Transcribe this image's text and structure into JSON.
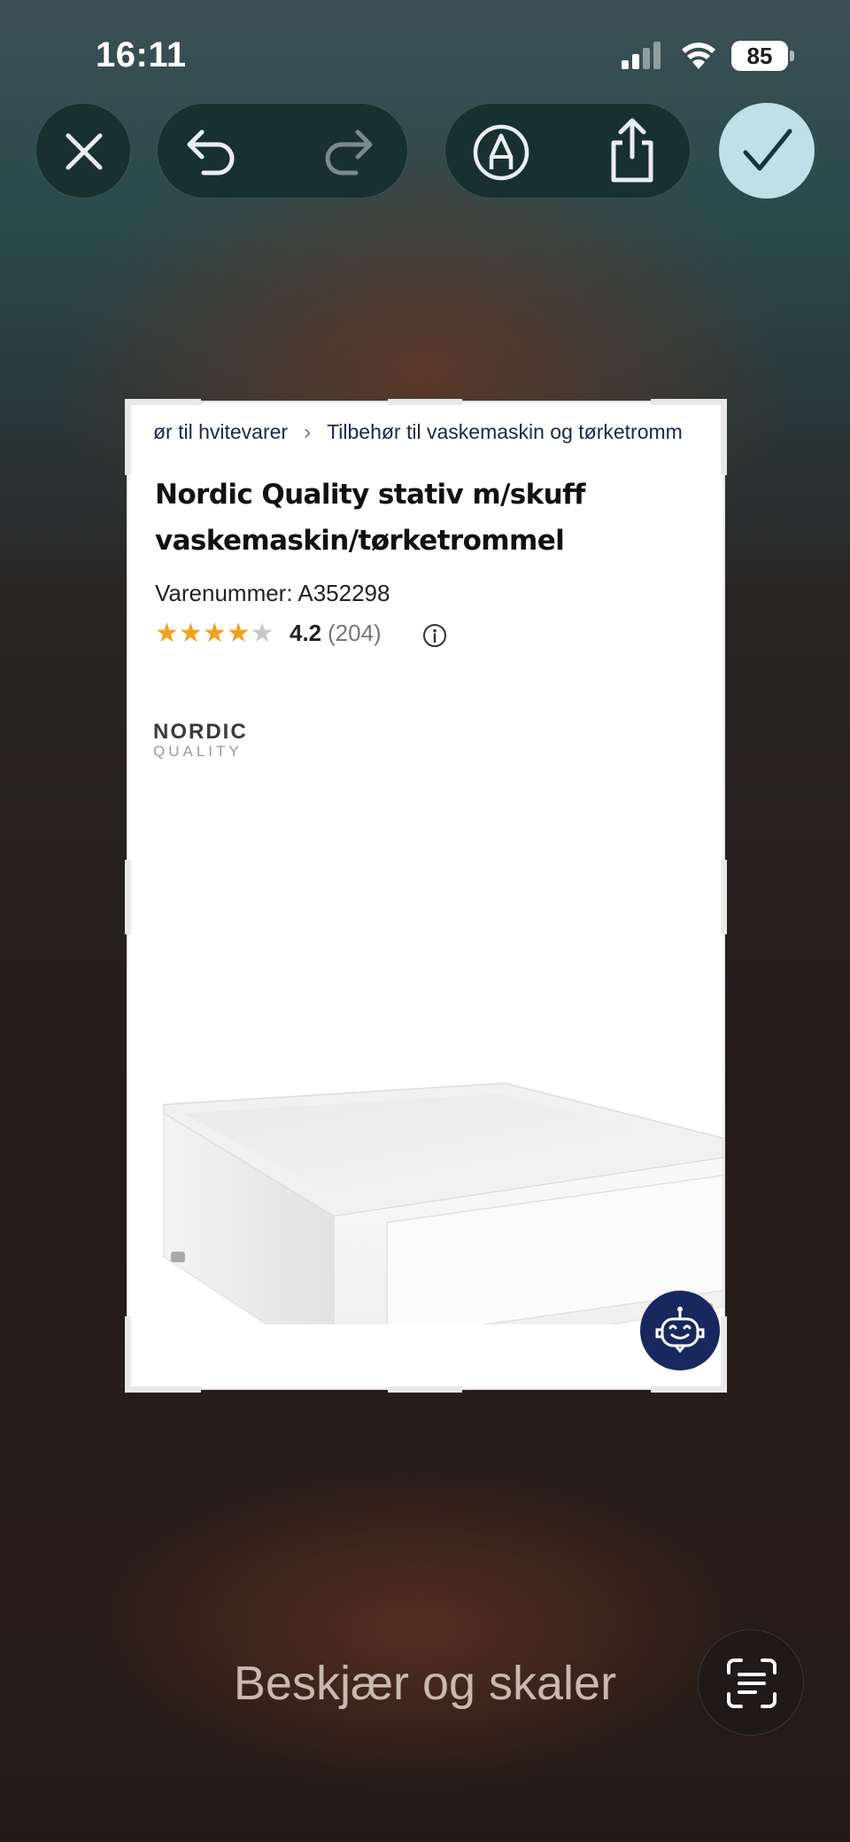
{
  "status_bar": {
    "time": "16:11",
    "battery": "85",
    "icons": [
      "signal-icon",
      "wifi-icon",
      "battery-icon"
    ]
  },
  "toolbar": {
    "buttons": [
      "close-icon",
      "undo-icon",
      "redo-icon",
      "markup-pen-icon",
      "share-icon",
      "checkmark-icon"
    ],
    "done_color": "#bfe0e6"
  },
  "screenshot": {
    "breadcrumb": {
      "items": [
        "ør til hvitevarer",
        "Tilbehør til vaskemaskin og tørketromm"
      ]
    },
    "title_line1": "Nordic Quality stativ m/skuff",
    "title_line2": "vaskemaskin/tørketrommel",
    "sku_label": "Varenummer:",
    "sku_value": "A352298",
    "rating": {
      "stars": 4,
      "max_stars": 5,
      "value": "4.2",
      "count": "(204)"
    },
    "brand_logo": {
      "name": "NORDIC",
      "sub": "QUALITY"
    },
    "chat_icon": "chatbot-icon",
    "star_color": "#f2a21b",
    "chat_color": "#18285f"
  },
  "bottom": {
    "mode_label": "Beskjær og skaler",
    "ocr_icon": "live-text-icon"
  }
}
